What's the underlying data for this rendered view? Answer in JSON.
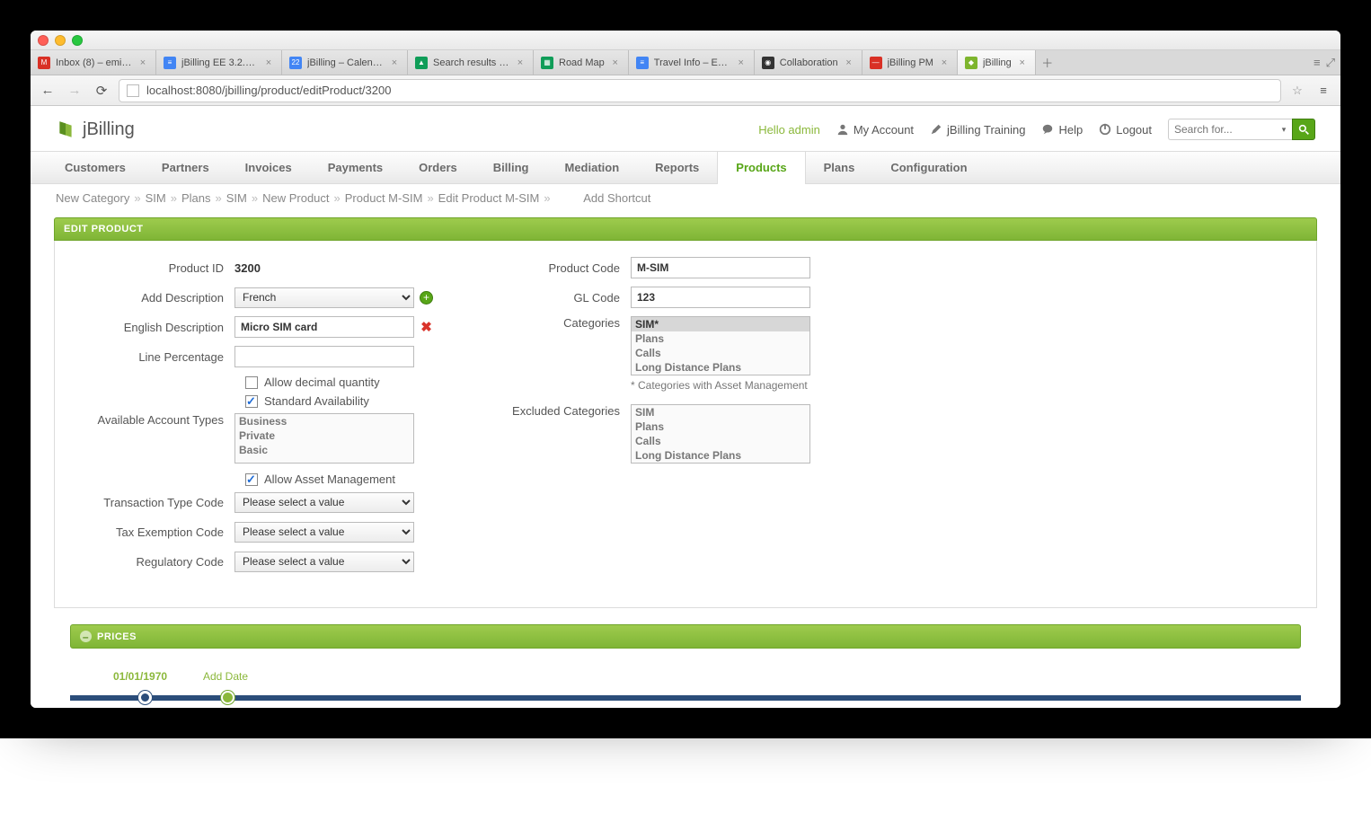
{
  "browser": {
    "tabs": [
      {
        "label": "Inbox (8) – emil…",
        "favColor": "#d93025",
        "favText": "M"
      },
      {
        "label": "jBilling EE 3.2.1 …",
        "favColor": "#4285f4",
        "favText": "≡"
      },
      {
        "label": "jBilling – Calend…",
        "favColor": "#4285f4",
        "favText": "22"
      },
      {
        "label": "Search results – …",
        "favColor": "#0f9d58",
        "favText": "▲"
      },
      {
        "label": "Road Map",
        "favColor": "#0f9d58",
        "favText": "▦"
      },
      {
        "label": "Travel Info – Em…",
        "favColor": "#4285f4",
        "favText": "≡"
      },
      {
        "label": "Collaboration",
        "favColor": "#333",
        "favText": "◉"
      },
      {
        "label": "jBilling PM",
        "favColor": "#d93025",
        "favText": "—"
      },
      {
        "label": "jBilling",
        "favColor": "#7eb52e",
        "favText": "◆",
        "active": true
      }
    ],
    "url": "localhost:8080/jbilling/product/editProduct/3200"
  },
  "header": {
    "brand": "jBilling",
    "greeting": "Hello admin",
    "links": {
      "account": "My Account",
      "training": "jBilling Training",
      "help": "Help",
      "logout": "Logout"
    },
    "searchPlaceholder": "Search for..."
  },
  "nav": {
    "items": [
      "Customers",
      "Partners",
      "Invoices",
      "Payments",
      "Orders",
      "Billing",
      "Mediation",
      "Reports",
      "Products",
      "Plans",
      "Configuration"
    ],
    "active": "Products"
  },
  "crumbs": {
    "items": [
      "New Category",
      "SIM",
      "Plans",
      "SIM",
      "New Product",
      "Product M-SIM",
      "Edit Product M-SIM"
    ],
    "shortcut": "Add Shortcut"
  },
  "panelTitle": "EDIT PRODUCT",
  "form": {
    "left": {
      "productIdLabel": "Product ID",
      "productId": "3200",
      "addDescLabel": "Add Description",
      "addDescValue": "French",
      "engDescLabel": "English Description",
      "engDescValue": "Micro SIM card",
      "linePctLabel": "Line Percentage",
      "linePctValue": "",
      "allowDecimal": "Allow decimal quantity",
      "stdAvail": "Standard Availability",
      "acctTypesLabel": "Available Account Types",
      "acctTypes": [
        "Business",
        "Private",
        "Basic"
      ],
      "allowAsset": "Allow Asset Management",
      "txnTypeLabel": "Transaction Type Code",
      "txnTypeValue": "Please select a value",
      "taxExLabel": "Tax Exemption Code",
      "taxExValue": "Please select a value",
      "regCodeLabel": "Regulatory Code",
      "regCodeValue": "Please select a value"
    },
    "right": {
      "productCodeLabel": "Product Code",
      "productCodeValue": "M-SIM",
      "glCodeLabel": "GL Code",
      "glCodeValue": "123",
      "categoriesLabel": "Categories",
      "categories": [
        "SIM*",
        "Plans",
        "Calls",
        "Long Distance Plans"
      ],
      "categoriesNote": "* Categories with Asset Management",
      "exclLabel": "Excluded Categories",
      "excl": [
        "SIM",
        "Plans",
        "Calls",
        "Long Distance Plans"
      ]
    }
  },
  "prices": {
    "title": "PRICES",
    "startDate": "01/01/1970",
    "addDate": "Add Date"
  }
}
